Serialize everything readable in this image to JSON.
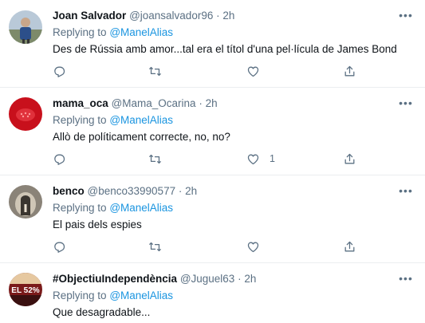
{
  "replying_label": "Replying to",
  "tweets": [
    {
      "name": "Joan Salvador",
      "handle": "@joansalvador96",
      "time": "2h",
      "mention": "@ManelAlias",
      "text": "Des de Rússia amb amor...tal era el títol d'una pel·lícula de James Bond",
      "like_count": ""
    },
    {
      "name": "mama_oca",
      "handle": "@Mama_Ocarina",
      "time": "2h",
      "mention": "@ManelAlias",
      "text": "Allò de políticament correcte, no, no?",
      "like_count": "1"
    },
    {
      "name": "benco",
      "handle": "@benco33990577",
      "time": "2h",
      "mention": "@ManelAlias",
      "text": "El pais dels espies",
      "like_count": ""
    },
    {
      "name": "#ObjectiuIndependència",
      "handle": "@Juguel63",
      "time": "2h",
      "mention": "@ManelAlias",
      "text": "Que desagradable...",
      "like_count": "",
      "avatar_text": "EL 52%"
    }
  ],
  "icons": {
    "more": "more-options-icon",
    "reply": "reply-icon",
    "retweet": "retweet-icon",
    "like": "like-icon",
    "share": "share-icon"
  },
  "colors": {
    "text": "#0f1419",
    "secondary": "#5b7083",
    "link": "#1b95e0",
    "divider": "#ebeef0"
  }
}
